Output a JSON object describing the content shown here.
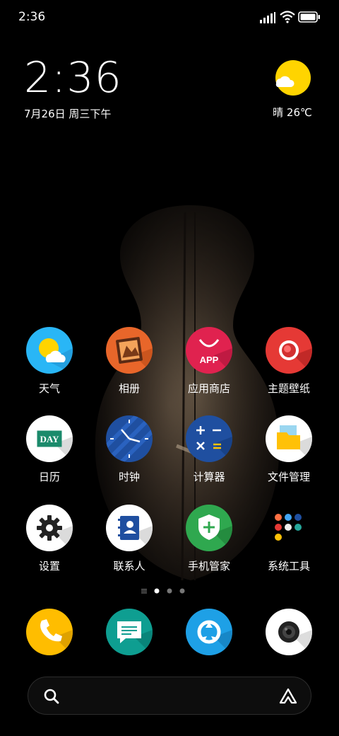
{
  "status_bar": {
    "time": "2:36",
    "icons": [
      "signal-icon",
      "wifi-icon",
      "battery-icon"
    ]
  },
  "clock_widget": {
    "time": "2:36",
    "date": "7月26日 周三下午"
  },
  "weather_widget": {
    "text": "晴 26℃",
    "icon": "sun-icon"
  },
  "apps": [
    {
      "label": "天气",
      "icon": "weather-icon"
    },
    {
      "label": "相册",
      "icon": "gallery-icon"
    },
    {
      "label": "应用商店",
      "icon": "app-store-icon",
      "icon_text": "APP"
    },
    {
      "label": "主题壁纸",
      "icon": "themes-icon"
    },
    {
      "label": "日历",
      "icon": "calendar-icon",
      "icon_text": "DAY"
    },
    {
      "label": "时钟",
      "icon": "clock-icon"
    },
    {
      "label": "计算器",
      "icon": "calculator-icon"
    },
    {
      "label": "文件管理",
      "icon": "file-manager-icon"
    },
    {
      "label": "设置",
      "icon": "settings-icon"
    },
    {
      "label": "联系人",
      "icon": "contacts-icon"
    },
    {
      "label": "手机管家",
      "icon": "security-icon"
    },
    {
      "label": "系统工具",
      "icon": "system-tools-folder-icon"
    }
  ],
  "page_indicator": {
    "pages": 3,
    "current": 1
  },
  "dock": [
    {
      "icon": "phone-icon"
    },
    {
      "icon": "messages-icon"
    },
    {
      "icon": "browser-icon"
    },
    {
      "icon": "camera-icon"
    }
  ],
  "search_bar": {
    "search_icon": "search-icon",
    "assistant_icon": "assistant-icon"
  },
  "colors": {
    "background": "#000000",
    "weather_blue": "#29b6f6",
    "gallery_orange": "#e8662a",
    "store_red": "#e0224f",
    "themes_red": "#e53935",
    "clock_blue": "#1f4fa0",
    "security_green": "#2fa84f",
    "phone_yellow": "#ffbd00",
    "messages_teal": "#0e9e91",
    "browser_blue": "#1ea0e6"
  }
}
